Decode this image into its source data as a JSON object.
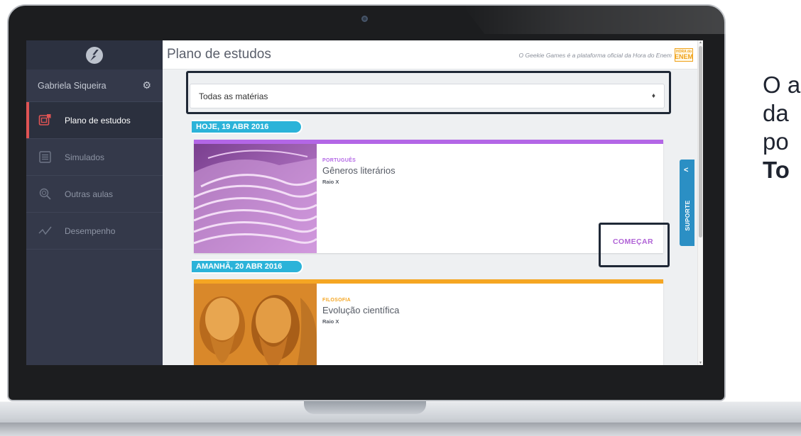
{
  "sidebar": {
    "user_name": "Gabriela Siqueira",
    "items": [
      {
        "label": "Plano de estudos",
        "icon": "study-plan-icon",
        "active": true
      },
      {
        "label": "Simulados",
        "icon": "exam-list-icon",
        "active": false
      },
      {
        "label": "Outras aulas",
        "icon": "search-lessons-icon",
        "active": false
      },
      {
        "label": "Desempenho",
        "icon": "performance-chart-icon",
        "active": false
      }
    ]
  },
  "header": {
    "title": "Plano de estudos",
    "tagline": "O Geekie Games é a plataforma oficial da Hora do Enem",
    "logo_top": "HORA do",
    "logo_bottom": "ENEM"
  },
  "filter": {
    "selected": "Todas as matérias"
  },
  "days": [
    {
      "date_label": "HOJE, 19 ABR 2016",
      "card": {
        "subject": "PORTUGUÊS",
        "topic": "Gêneros literários",
        "source": "Raio X",
        "action": "COMEÇAR",
        "accent": "#b366e6",
        "image": "open-book-photo"
      }
    },
    {
      "date_label": "AMANHÃ, 20 ABR 2016",
      "card": {
        "subject": "FILOSOFIA",
        "topic": "Evolução científica",
        "source": "Raio X",
        "accent": "#f5a623",
        "image": "philosopher-busts-photo"
      }
    }
  ],
  "support": {
    "label": "SUPORTE"
  },
  "side_caption": {
    "line1": "O a",
    "line2": "da",
    "line3": "po",
    "line4": "To"
  },
  "colors": {
    "sidebar_bg": "#34394a",
    "active_marker": "#e05454",
    "date_pill": "#2bb3d9",
    "support_tab": "#2b8fc4"
  }
}
